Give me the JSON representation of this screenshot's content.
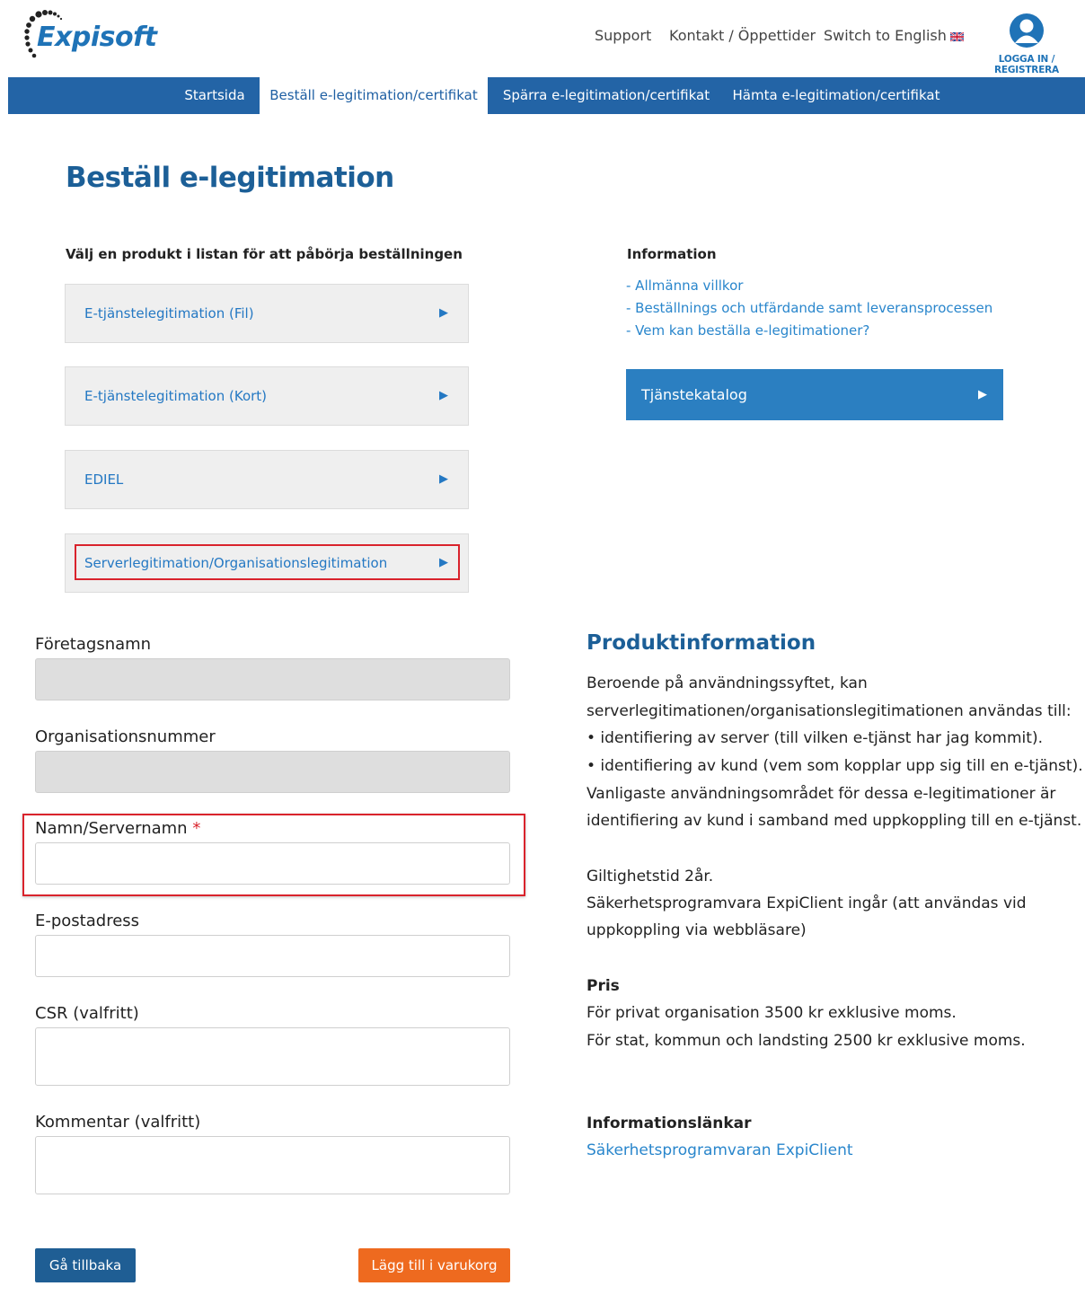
{
  "header": {
    "logo_text": "Expisoft",
    "nav": [
      "Support",
      "Kontakt / Öppettider",
      "Switch to English"
    ],
    "login_label": "LOGGA IN / REGISTRERA"
  },
  "mainnav": {
    "tabs": [
      "Startsida",
      "Beställ e-legitimation/certifikat",
      "Spärra e-legitimation/certifikat",
      "Hämta e-legitimation/certifikat"
    ],
    "active_index": 1
  },
  "page": {
    "title": "Beställ e-legitimation",
    "select_heading": "Välj en produkt i listan för att påbörja beställningen",
    "products": [
      "E-tjänstelegitimation (Fil)",
      "E-tjänstelegitimation (Kort)",
      "EDIEL",
      "Serverlegitimation/Organisationslegitimation"
    ],
    "arrow": "▶"
  },
  "information": {
    "heading": "Information",
    "links": [
      "- Allmänna villkor",
      "- Beställnings och utfärdande samt leveransprocessen",
      "- Vem kan beställa e-legitimationer?"
    ],
    "catalog_button": "Tjänstekatalog"
  },
  "form": {
    "company_label": "Företagsnamn",
    "orgnr_label": "Organisationsnummer",
    "name_label": "Namn/Servernamn",
    "required_mark": "*",
    "email_label": "E-postadress",
    "csr_label": "CSR (valfritt)",
    "comment_label": "Kommentar (valfritt)",
    "back_button": "Gå tillbaka",
    "cart_button": "Lägg till i varukorg"
  },
  "product_info": {
    "title": "Produktinformation",
    "lines": [
      "Beroende på användningssyftet, kan",
      "serverlegitimationen/organisationslegitimationen användas till:",
      "• identifiering av server (till vilken e-tjänst har jag kommit).",
      "• identifiering av kund (vem som kopplar upp sig till en e-tjänst).",
      "Vanligaste användningsområdet för dessa e-legitimationer är",
      "identifiering av kund i samband med uppkoppling till en e-tjänst."
    ],
    "validity_lines": [
      "Giltighetstid 2år.",
      "Säkerhetsprogramvara ExpiClient ingår (att användas vid",
      "uppkoppling via webbläsare)"
    ],
    "price_heading": "Pris",
    "price_lines": [
      "För privat organisation 3500 kr exklusive moms.",
      "För stat, kommun och landsting 2500 kr exklusive moms."
    ],
    "links_heading": "Informationslänkar",
    "link": "Säkerhetsprogramvaran ExpiClient"
  }
}
